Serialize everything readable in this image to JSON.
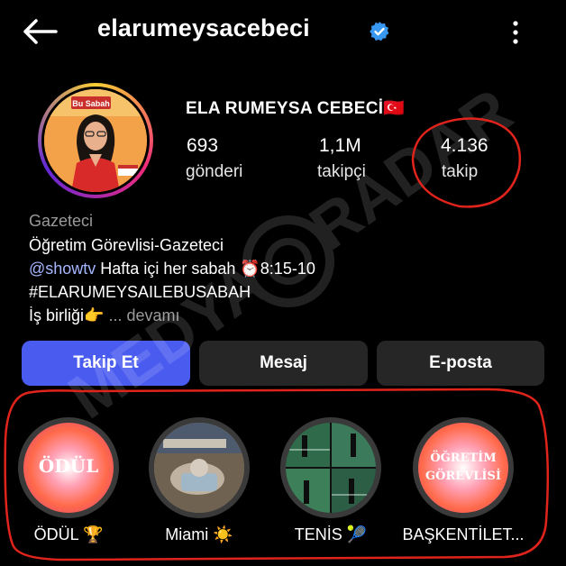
{
  "header": {
    "username": "elarumeysacebeci",
    "verified_icon": "verified-badge-icon",
    "back_icon": "back-arrow-icon",
    "menu_icon": "more-vertical-icon"
  },
  "profile": {
    "display_name": "ELA RUMEYSA CEBECİ🇹🇷",
    "avatar_caption": "Bu Sabah",
    "stats": [
      {
        "value": "693",
        "label": "gönderi"
      },
      {
        "value": "1,1M",
        "label": "takipçi"
      },
      {
        "value": "4.136",
        "label": "takip"
      }
    ]
  },
  "bio": {
    "category": "Gazeteci",
    "line1": "Öğretim Görevlisi-Gazeteci",
    "mention": "@showtv",
    "line2_rest": " Hafta içi her sabah ⏰8:15-10",
    "line3": "#ELARUMEYSAILEBUSABAH",
    "line4": "İş birliği👉",
    "more": " ... devamı"
  },
  "actions": {
    "follow": "Takip Et",
    "message": "Mesaj",
    "email": "E-posta"
  },
  "highlights": [
    {
      "label": "ÖDÜL 🏆",
      "cover_text": "ÖDÜL"
    },
    {
      "label": "Miami ☀️",
      "cover_text": ""
    },
    {
      "label": "TENİS 🎾",
      "cover_text": ""
    },
    {
      "label": "BAŞKENTİLET...",
      "cover_text": "ÖĞRETİM\nGÖREVLİSİ"
    }
  ],
  "watermark": "MEDYA RADAR",
  "colors": {
    "follow_button": "#4a5cf0",
    "secondary_button": "#262626",
    "annotation": "#e0241b",
    "verified": "#3897f0"
  }
}
